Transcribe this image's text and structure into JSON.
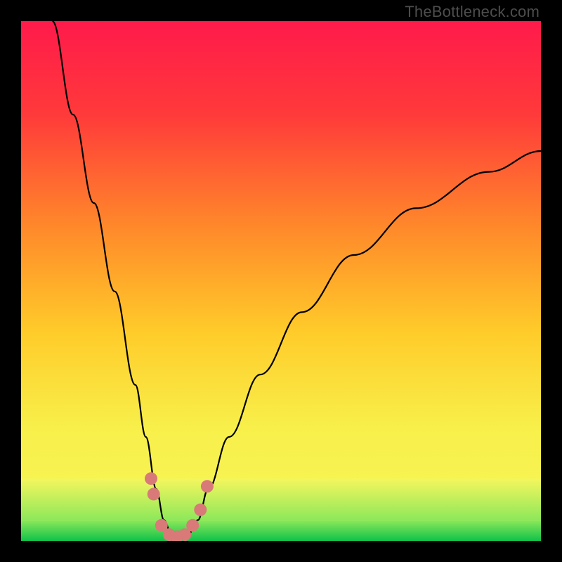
{
  "watermark": "TheBottleneck.com",
  "chart_data": {
    "type": "line",
    "title": "",
    "xlabel": "",
    "ylabel": "",
    "xlim": [
      0,
      100
    ],
    "ylim": [
      0,
      100
    ],
    "series": [
      {
        "name": "bottleneck-curve",
        "x": [
          6,
          10,
          14,
          18,
          22,
          24,
          26,
          27.5,
          29,
          30.5,
          32,
          34,
          36,
          40,
          46,
          54,
          64,
          76,
          90,
          100
        ],
        "y": [
          100,
          82,
          65,
          48,
          30,
          20,
          10,
          4,
          1,
          0.5,
          1,
          4,
          10,
          20,
          32,
          44,
          55,
          64,
          71,
          75
        ]
      }
    ],
    "markers": {
      "name": "highlight-points",
      "color": "#d97a78",
      "points": [
        {
          "x": 25.0,
          "y": 12.0
        },
        {
          "x": 25.5,
          "y": 9.0
        },
        {
          "x": 27.0,
          "y": 3.0
        },
        {
          "x": 28.5,
          "y": 1.2
        },
        {
          "x": 30.0,
          "y": 0.8
        },
        {
          "x": 31.5,
          "y": 1.2
        },
        {
          "x": 33.0,
          "y": 3.0
        },
        {
          "x": 34.5,
          "y": 6.0
        },
        {
          "x": 35.8,
          "y": 10.5
        }
      ]
    },
    "bands": [
      {
        "name": "green-zone",
        "y0": 0,
        "y1": 4,
        "color_top": "#36e06a",
        "color_bot": "#10c24a"
      },
      {
        "name": "yellow-green",
        "y0": 4,
        "y1": 12,
        "color_top": "#f4f65e",
        "color_bot": "#8de85a"
      }
    ],
    "gradient_stops": [
      {
        "offset": 0,
        "color": "#ff1a4b"
      },
      {
        "offset": 18,
        "color": "#ff3a3a"
      },
      {
        "offset": 40,
        "color": "#ff8a2a"
      },
      {
        "offset": 60,
        "color": "#ffcc2a"
      },
      {
        "offset": 78,
        "color": "#f8ef4a"
      },
      {
        "offset": 100,
        "color": "#f5f85a"
      }
    ]
  }
}
